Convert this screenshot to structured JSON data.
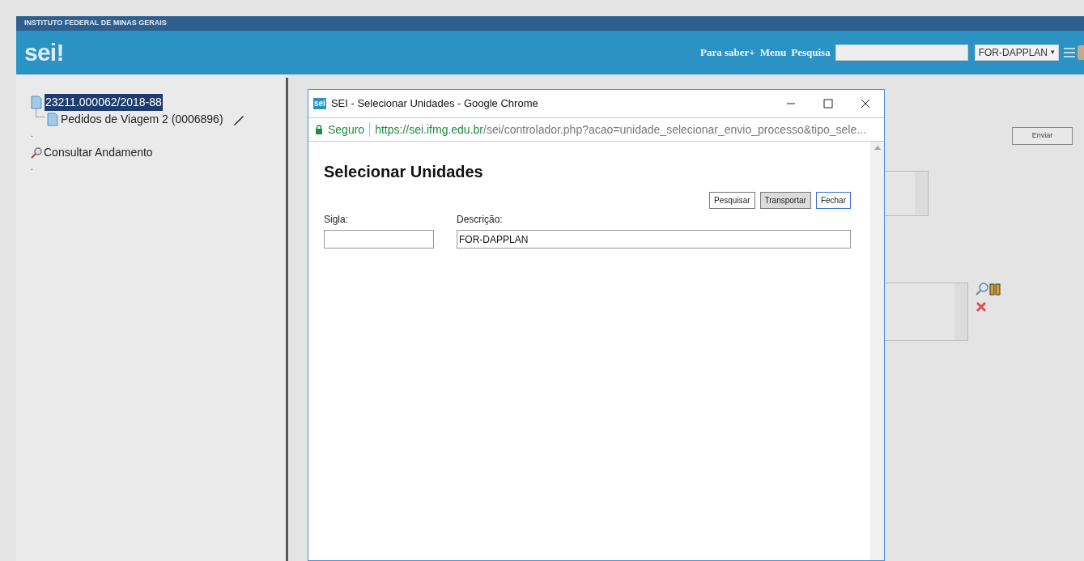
{
  "header": {
    "institution": "INSTITUTO FEDERAL DE MINAS GERAIS",
    "logo": "sei!",
    "links": [
      "Para saber+",
      "Menu",
      "Pesquisa"
    ],
    "unit_select": {
      "value": "FOR-DAPPLAN",
      "caret": "▾"
    }
  },
  "tree": {
    "process": {
      "label": "23211.000062/2018-88",
      "selected": true,
      "children": [
        {
          "label": "Pedidos de Viagem 2 (0006896)"
        }
      ]
    },
    "separators": [
      ".",
      "."
    ],
    "actions": [
      {
        "label": "Consultar Andamento"
      }
    ]
  },
  "background_form": {
    "buttons": [
      "Enviar"
    ]
  },
  "popup": {
    "window_title": "SEI - Selecionar Unidades - Google Chrome",
    "favicon": "sei",
    "security": "Seguro",
    "url_host": "https://sei.ifmg.edu.br",
    "url_path": "/sei/controlador.php?acao=unidade_selecionar_envio_processo&tipo_sele...",
    "heading": "Selecionar Unidades",
    "buttons": [
      {
        "label": "Pesquisar",
        "selected": false
      },
      {
        "label": "Transportar",
        "selected": false,
        "pressed": true
      },
      {
        "label": "Fechar",
        "selected": true,
        "pressed": false
      }
    ],
    "fields": [
      {
        "label": "Sigla:"
      },
      {
        "label": "Descrição:",
        "value": "FOR-DAPPLAN"
      }
    ]
  }
}
